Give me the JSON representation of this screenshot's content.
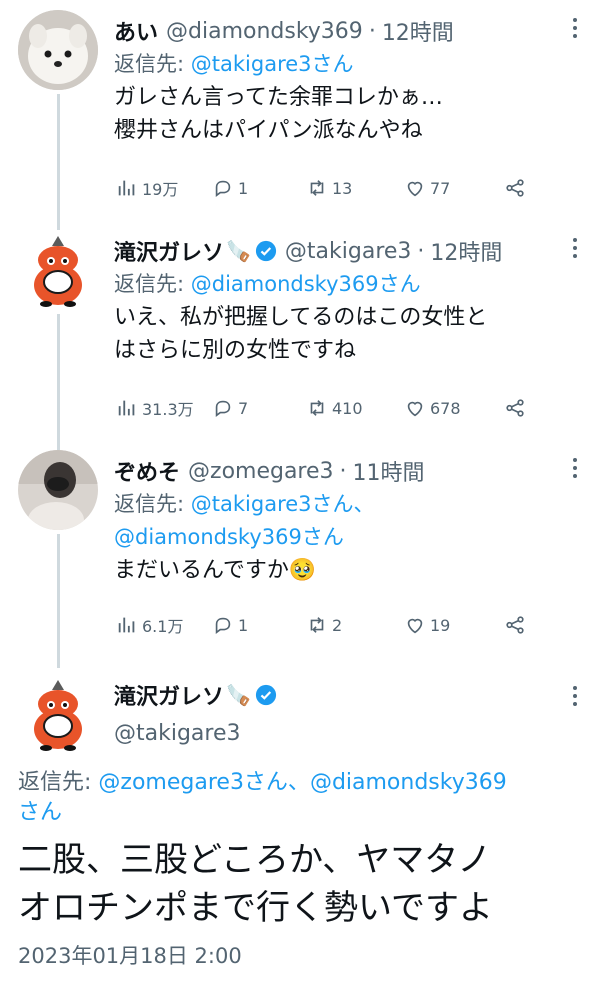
{
  "tweets": [
    {
      "name": "あい",
      "handle": "@diamondsky369",
      "time": "12時間",
      "reply_prefix": "返信先:",
      "reply_to": "@takigare3さん",
      "body": [
        "ガレさん言ってた余罪コレかぁ…",
        "櫻井さんはパイパン派なんやね"
      ],
      "stats": {
        "views": "19万",
        "replies": "1",
        "retweets": "13",
        "likes": "77"
      }
    },
    {
      "name": "滝沢ガレソ",
      "handle": "@takigare3",
      "time": "12時間",
      "reply_prefix": "返信先:",
      "reply_to": "@diamondsky369さん",
      "body": [
        "いえ、私が把握してるのはこの女性と",
        "はさらに別の女性ですね"
      ],
      "stats": {
        "views": "31.3万",
        "replies": "7",
        "retweets": "410",
        "likes": "678"
      }
    },
    {
      "name": "ぞめそ",
      "handle": "@zomegare3",
      "time": "11時間",
      "reply_prefix": "返信先:",
      "reply_to": "@takigare3さん、",
      "reply_to_2": "@diamondsky369さん",
      "body": [
        "まだいるんですか🥹"
      ],
      "stats": {
        "views": "6.1万",
        "replies": "1",
        "retweets": "2",
        "likes": "19"
      }
    }
  ],
  "main_tweet": {
    "name": "滝沢ガレソ",
    "handle": "@takigare3",
    "reply_prefix": "返信先:",
    "reply_to_1": "@zomegare3さん、",
    "reply_to_2": "@diamondsky369",
    "reply_to_3": "さん",
    "body_line1": "二股、三股どころか、ヤマタノ",
    "body_line2": "オロチンポまで行く勢いですよ",
    "timestamp": "2023年01月18日 2:00"
  },
  "colors": {
    "accent": "#1d9bf0",
    "secondary_text": "#536471",
    "primary_text": "#0f1419",
    "thread_line": "#cfd9de"
  }
}
